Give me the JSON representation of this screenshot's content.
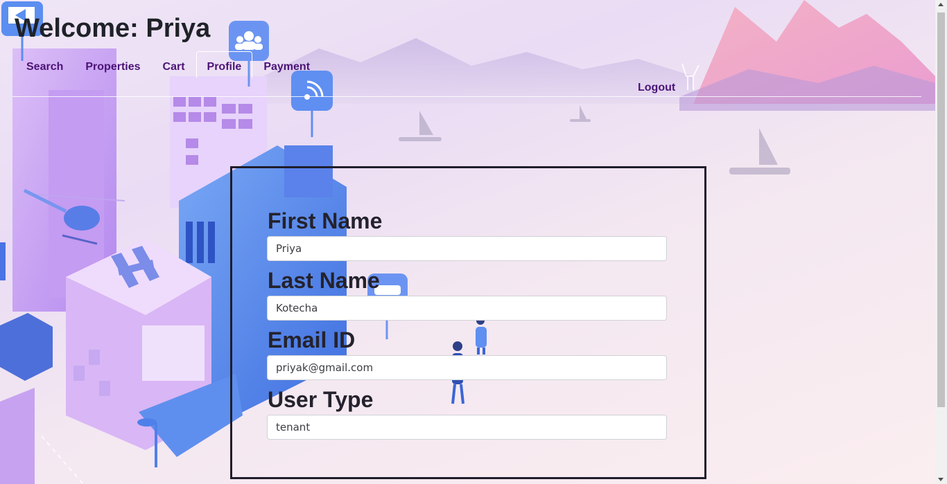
{
  "header": {
    "welcome_prefix": "Welcome:",
    "user_name": "Priya",
    "nav": [
      {
        "label": "Search"
      },
      {
        "label": "Properties"
      },
      {
        "label": "Cart"
      },
      {
        "label": "Profile"
      },
      {
        "label": "Payment"
      }
    ],
    "active_nav": "Profile",
    "logout_label": "Logout"
  },
  "profile_form": {
    "fields": [
      {
        "label": "First Name",
        "value": "Priya"
      },
      {
        "label": "Last Name",
        "value": "Kotecha"
      },
      {
        "label": "Email ID",
        "value": "priyak@gmail.com"
      },
      {
        "label": "User Type",
        "value": "tenant"
      }
    ]
  },
  "colors": {
    "nav_text": "#4b1476",
    "heading_text": "#1f2228",
    "form_border": "#1f1d2b",
    "background_accent": "#b48cf0"
  },
  "background_icons": [
    "video-icon",
    "group-icon",
    "wifi-icon",
    "car-icon",
    "helicopter-illustration",
    "city-buildings-illustration",
    "people-illustration",
    "sailboat-illustration",
    "mountains-illustration"
  ]
}
